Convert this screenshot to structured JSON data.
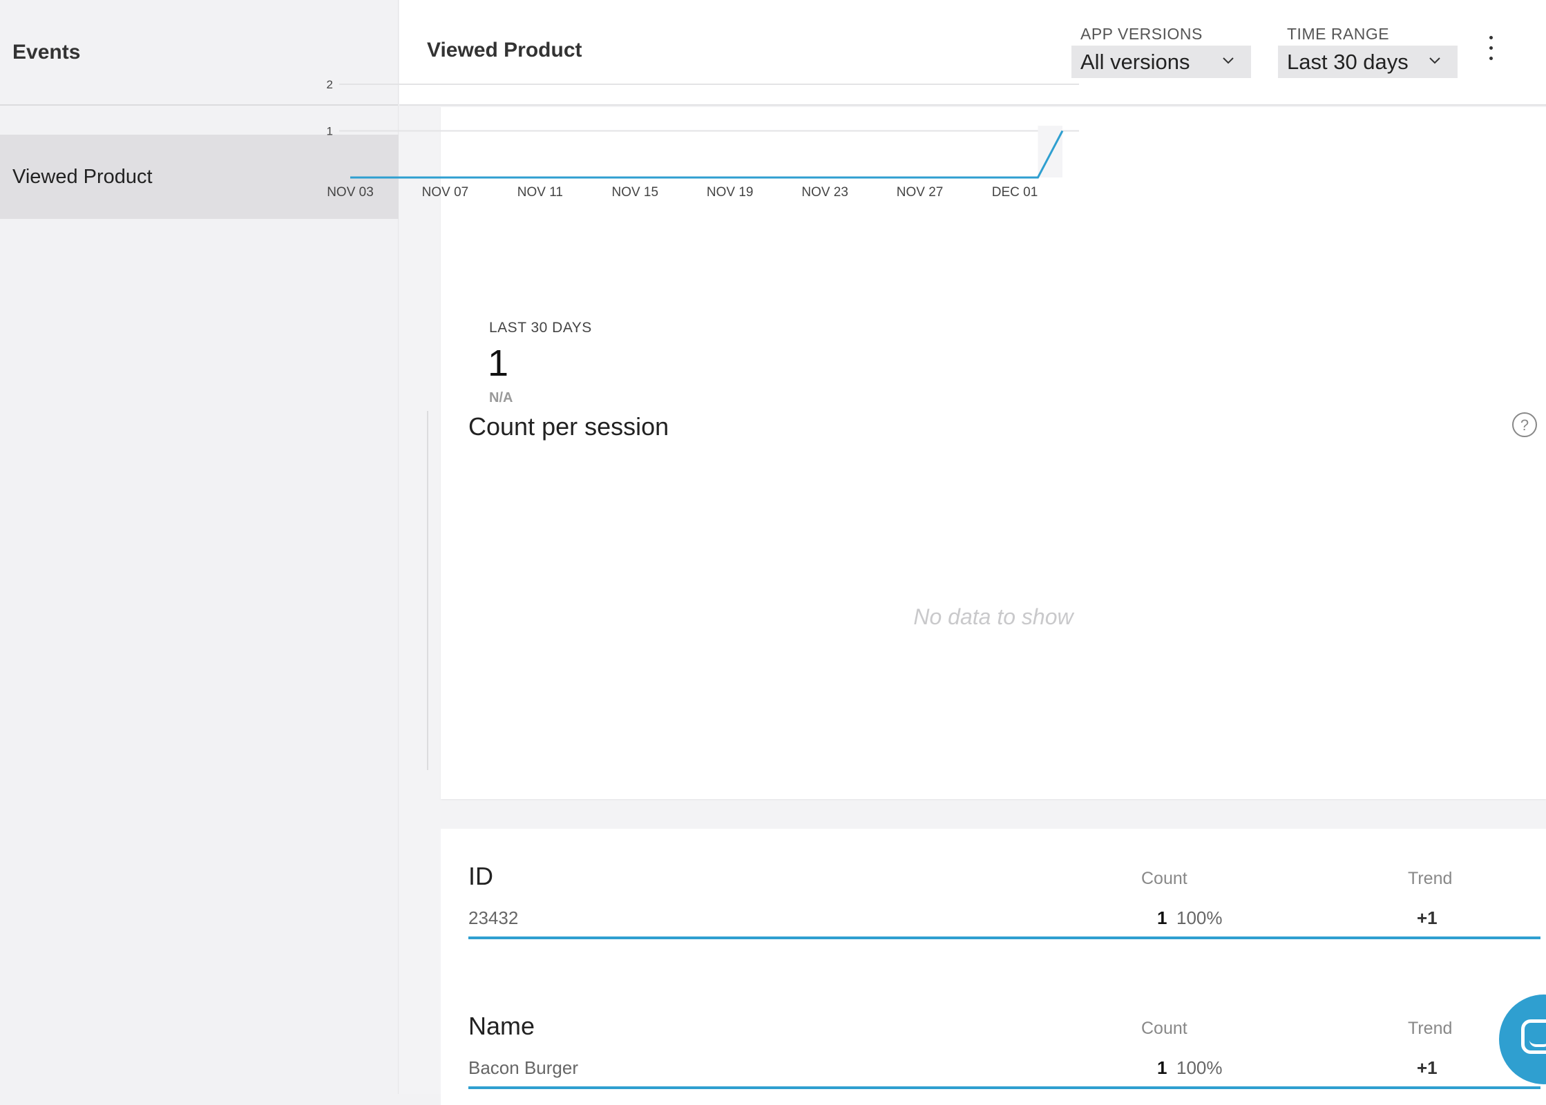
{
  "sidebar": {
    "title": "Events",
    "items": [
      {
        "label": "Viewed Product",
        "selected": true
      }
    ]
  },
  "header": {
    "title": "Viewed Product",
    "app_versions": {
      "label": "APP VERSIONS",
      "value": "All versions"
    },
    "time_range": {
      "label": "TIME RANGE",
      "value": "Last 30 days"
    }
  },
  "chart_data": {
    "type": "line",
    "title": "",
    "xlabel": "",
    "ylabel": "",
    "x_ticks": [
      "NOV 03",
      "NOV 07",
      "NOV 11",
      "NOV 15",
      "NOV 19",
      "NOV 23",
      "NOV 27",
      "DEC 01"
    ],
    "y_ticks": [
      1,
      2
    ],
    "ylim": [
      0,
      2
    ],
    "x": [
      "Nov 03",
      "Nov 04",
      "Nov 05",
      "Nov 06",
      "Nov 07",
      "Nov 08",
      "Nov 09",
      "Nov 10",
      "Nov 11",
      "Nov 12",
      "Nov 13",
      "Nov 14",
      "Nov 15",
      "Nov 16",
      "Nov 17",
      "Nov 18",
      "Nov 19",
      "Nov 20",
      "Nov 21",
      "Nov 22",
      "Nov 23",
      "Nov 24",
      "Nov 25",
      "Nov 26",
      "Nov 27",
      "Nov 28",
      "Nov 29",
      "Nov 30",
      "Dec 01",
      "Dec 02"
    ],
    "series": [
      {
        "values": [
          0,
          0,
          0,
          0,
          0,
          0,
          0,
          0,
          0,
          0,
          0,
          0,
          0,
          0,
          0,
          0,
          0,
          0,
          0,
          0,
          0,
          0,
          0,
          0,
          0,
          0,
          0,
          0,
          0,
          1
        ]
      }
    ],
    "grid": true,
    "color": "#2f9fd0"
  },
  "summary": {
    "label": "LAST 30 DAYS",
    "value": "1",
    "sub": "N/A"
  },
  "count_per_session": {
    "title": "Count per session",
    "empty_text": "No data to show"
  },
  "properties": [
    {
      "title": "ID",
      "count_header": "Count",
      "trend_header": "Trend",
      "rows": [
        {
          "label": "23432",
          "count": "1",
          "percent": "100%",
          "trend": "+1"
        }
      ]
    },
    {
      "title": "Name",
      "count_header": "Count",
      "trend_header": "Trend",
      "rows": [
        {
          "label": "Bacon Burger",
          "count": "1",
          "percent": "100%",
          "trend": "+1"
        }
      ]
    }
  ]
}
